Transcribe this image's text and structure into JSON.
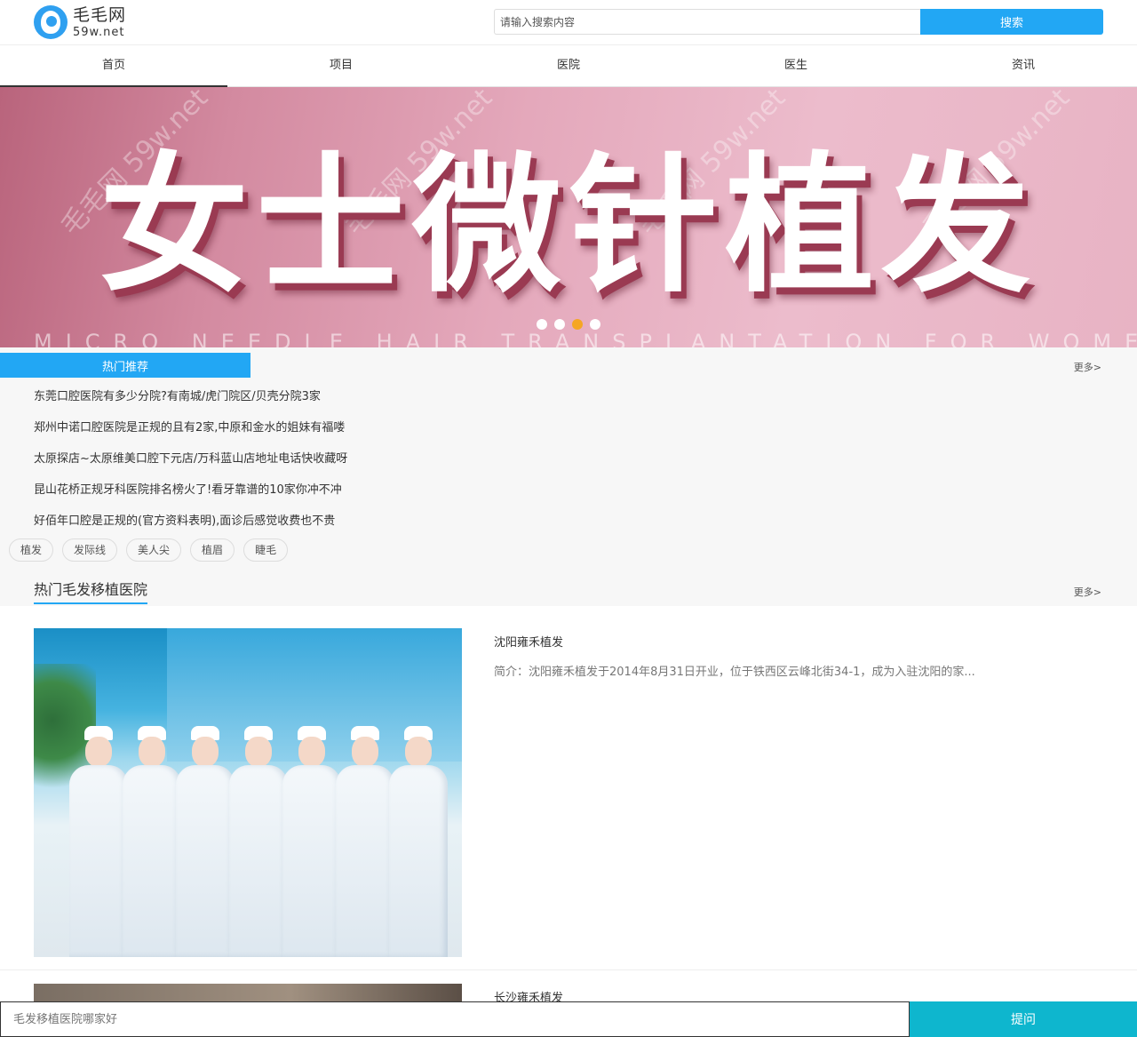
{
  "header": {
    "logo_cn": "毛毛网",
    "logo_en": "59w.net",
    "search_placeholder": "请输入搜索内容",
    "search_button": "搜索"
  },
  "nav": {
    "items": [
      {
        "label": "首页"
      },
      {
        "label": "项目"
      },
      {
        "label": "医院"
      },
      {
        "label": "医生"
      },
      {
        "label": "资讯"
      }
    ]
  },
  "banner": {
    "title": "女士微针植发",
    "subtitle": "MICRO NEEDLE HAIR TRANSPLANTATION FOR WOMEN",
    "watermark": "毛毛网 59w.net",
    "slide_count": 4,
    "active_slide": 3
  },
  "hot": {
    "tab_label": "热门推荐",
    "more": "更多>",
    "items": [
      "东莞口腔医院有多少分院?有南城/虎门院区/贝壳分院3家",
      "郑州中诺口腔医院是正规的且有2家,中原和金水的姐妹有福喽",
      "太原探店~太原维美口腔下元店/万科蓝山店地址电话快收藏呀",
      "昆山花桥正规牙科医院排名榜火了!看牙靠谱的10家你冲不冲",
      "好佰年口腔是正规的(官方资料表明),面诊后感觉收费也不贵"
    ],
    "tags": [
      "植发",
      "发际线",
      "美人尖",
      "植眉",
      "睫毛"
    ]
  },
  "hospitals": {
    "title": "热门毛发移植医院",
    "more": "更多>",
    "list": [
      {
        "name": "沈阳雍禾植发",
        "desc": "简介：沈阳雍禾植发于2014年8月31日开业，位于铁西区云峰北街34-1，成为入驻沈阳的家..."
      },
      {
        "name": "长沙雍禾植发"
      }
    ]
  },
  "ask": {
    "placeholder": "毛发移植医院哪家好",
    "button": "提问"
  }
}
